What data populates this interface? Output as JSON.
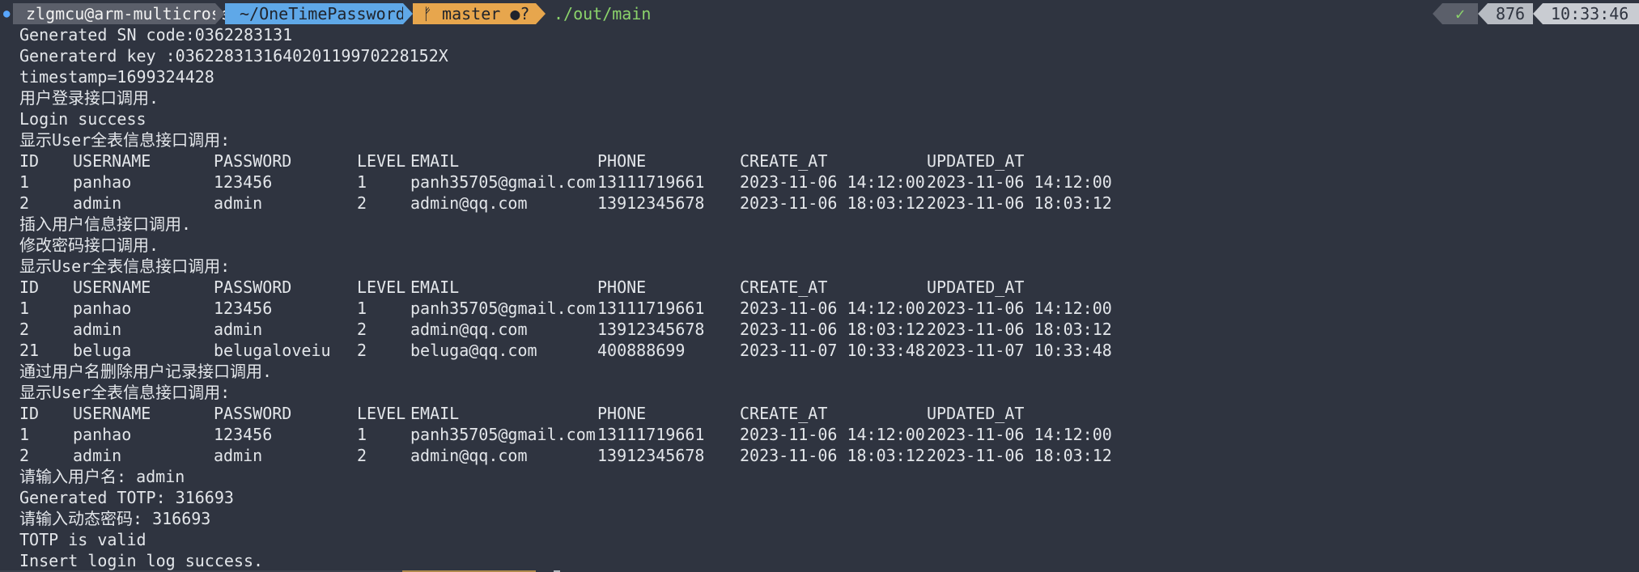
{
  "prompt": {
    "user_host": "zlgmcu@arm-multicross",
    "directory": "~/OneTimePassword",
    "git_branch": "ᚠ master ●?",
    "command": "./out/main",
    "status_ok": "✓",
    "history_number": "876",
    "time": "10:33:46"
  },
  "output": {
    "sn_line": "Generated SN code:0362283131",
    "key_line": "Generaterd key :036228313164020119970228152X",
    "timestamp_line": "timestamp=1699324428",
    "login_call": "用户登录接口调用.",
    "login_success": "Login success",
    "show_all_1": "显示User全表信息接口调用:",
    "insert_call": "插入用户信息接口调用.",
    "change_pwd_call": "修改密码接口调用.",
    "show_all_2": "显示User全表信息接口调用:",
    "delete_call": "通过用户名删除用户记录接口调用.",
    "show_all_3": "显示User全表信息接口调用:",
    "input_user": "请输入用户名: admin",
    "totp_generated": "Generated TOTP: 316693",
    "input_otp": "请输入动态密码: 316693",
    "totp_valid": "TOTP is valid",
    "insert_log": "Insert login log success."
  },
  "table_headers": [
    "ID",
    "USERNAME",
    "PASSWORD",
    "LEVEL",
    "EMAIL",
    "PHONE",
    "CREATE_AT",
    "UPDATED_AT"
  ],
  "table1": [
    [
      "1",
      "panhao",
      "123456",
      "1",
      "panh35705@gmail.com",
      "13111719661",
      "2023-11-06 14:12:00",
      "2023-11-06 14:12:00"
    ],
    [
      "2",
      "admin",
      "admin",
      "2",
      "admin@qq.com",
      "13912345678",
      "2023-11-06 18:03:12",
      "2023-11-06 18:03:12"
    ]
  ],
  "table2": [
    [
      "1",
      "panhao",
      "123456",
      "1",
      "panh35705@gmail.com",
      "13111719661",
      "2023-11-06 14:12:00",
      "2023-11-06 14:12:00"
    ],
    [
      "2",
      "admin",
      "admin",
      "2",
      "admin@qq.com",
      "13912345678",
      "2023-11-06 18:03:12",
      "2023-11-06 18:03:12"
    ],
    [
      "21",
      "beluga",
      "belugaloveiu",
      "2",
      "beluga@qq.com",
      "400888699",
      "2023-11-07 10:33:48",
      "2023-11-07 10:33:48"
    ]
  ],
  "table3": [
    [
      "1",
      "panhao",
      "123456",
      "1",
      "panh35705@gmail.com",
      "13111719661",
      "2023-11-06 14:12:00",
      "2023-11-06 14:12:00"
    ],
    [
      "2",
      "admin",
      "admin",
      "2",
      "admin@qq.com",
      "13912345678",
      "2023-11-06 18:03:12",
      "2023-11-06 18:03:12"
    ]
  ]
}
